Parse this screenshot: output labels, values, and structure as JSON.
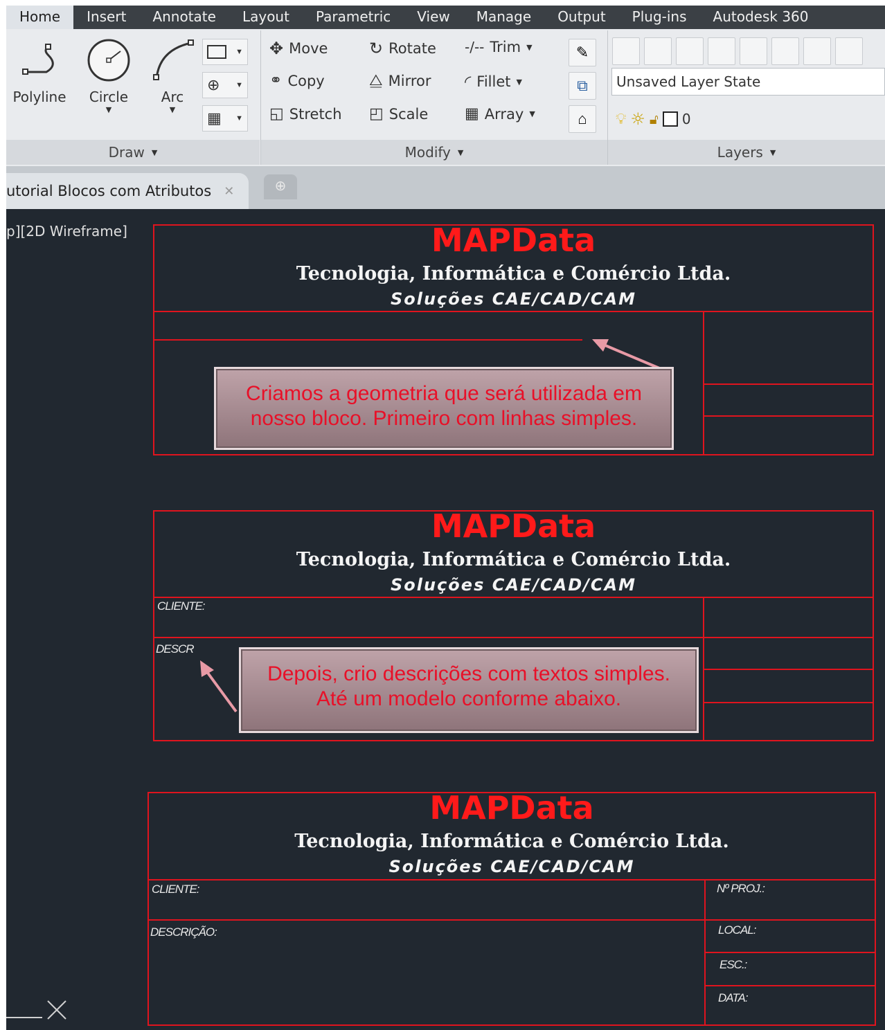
{
  "menu": [
    "Home",
    "Insert",
    "Annotate",
    "Layout",
    "Parametric",
    "View",
    "Manage",
    "Output",
    "Plug-ins",
    "Autodesk 360"
  ],
  "draw": {
    "polyline": "Polyline",
    "circle": "Circle",
    "arc": "Arc",
    "panel": "Draw"
  },
  "modify": {
    "move": "Move",
    "rotate": "Rotate",
    "trim": "Trim",
    "copy": "Copy",
    "mirror": "Mirror",
    "fillet": "Fillet",
    "stretch": "Stretch",
    "scale": "Scale",
    "array": "Array",
    "panel": "Modify"
  },
  "layers": {
    "state": "Unsaved Layer State",
    "current": "0",
    "panel": "Layers"
  },
  "tab": {
    "title": "utorial Blocos com Atributos"
  },
  "viewport": {
    "label": "p][2D Wireframe]"
  },
  "block": {
    "brand": "MAPData",
    "company": "Tecnologia,  Informática e Comércio Ltda.",
    "tagline": "Soluções CAE/CAD/CAM"
  },
  "callouts": {
    "c1": [
      "Criamos a geometria que será utilizada em",
      "nosso bloco. Primeiro com linhas simples."
    ],
    "c2": [
      "Depois, crio descrições com textos simples.",
      "Até um modelo conforme abaixo."
    ]
  },
  "fields2": {
    "cliente": "CLIENTE:",
    "descr": "DESCR"
  },
  "fields3": {
    "cliente": "CLIENTE:",
    "descricao": "DESCRIÇÃO:",
    "nproj": "Nº PROJ.:",
    "local": "LOCAL:",
    "esc": "ESC.:",
    "data": "DATA:"
  },
  "colors": {
    "line": "#e0141e",
    "brand": "#ff1a1a",
    "canvas": "#212830"
  }
}
